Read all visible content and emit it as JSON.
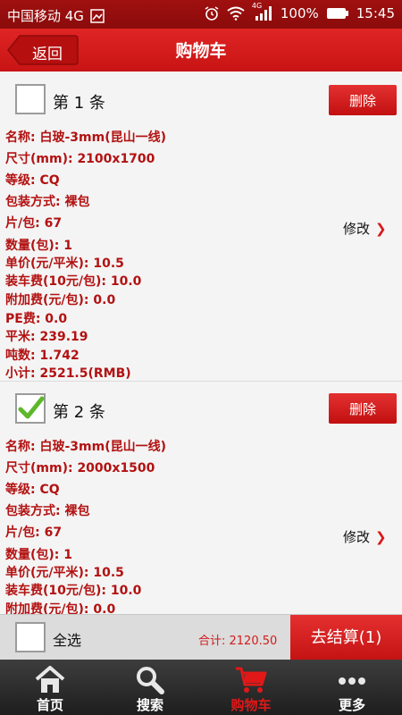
{
  "status_bar": {
    "carrier": "中国移动 4G",
    "battery": "100%",
    "time": "15:45",
    "network_badge": "4G"
  },
  "header": {
    "back_label": "返回",
    "title": "购物车"
  },
  "items": [
    {
      "number_label": "第 1 条",
      "checked": false,
      "delete_label": "删除",
      "edit_label": "修改",
      "fields": [
        "名称: 白玻-3mm(昆山一线)",
        "尺寸(mm): 2100x1700",
        "等级: CQ",
        "包装方式: 裸包",
        "片/包: 67",
        "数量(包): 1",
        "单价(元/平米): 10.5",
        "装车费(10元/包): 10.0",
        "附加费(元/包): 0.0",
        "PE费: 0.0",
        "平米: 239.19",
        "吨数: 1.742",
        "小计: 2521.5(RMB)"
      ]
    },
    {
      "number_label": "第 2 条",
      "checked": true,
      "delete_label": "删除",
      "edit_label": "修改",
      "fields": [
        "名称: 白玻-3mm(昆山一线)",
        "尺寸(mm): 2000x1500",
        "等级: CQ",
        "包装方式: 裸包",
        "片/包: 67",
        "数量(包): 1",
        "单价(元/平米): 10.5",
        "装车费(10元/包): 10.0",
        "附加费(元/包): 0.0"
      ]
    }
  ],
  "action_bar": {
    "select_all_label": "全选",
    "total_label": "合计: 2120.50",
    "checkout_label": "去结算(1)"
  },
  "tabs": [
    {
      "label": "首页",
      "icon": "home-icon",
      "active": false
    },
    {
      "label": "搜索",
      "icon": "search-icon",
      "active": false
    },
    {
      "label": "购物车",
      "icon": "cart-icon",
      "active": true
    },
    {
      "label": "更多",
      "icon": "more-icon",
      "active": false
    }
  ],
  "colors": {
    "accent": "#d01818",
    "field_text": "#b31111",
    "tabbar_bg": "#2a2a2a"
  }
}
